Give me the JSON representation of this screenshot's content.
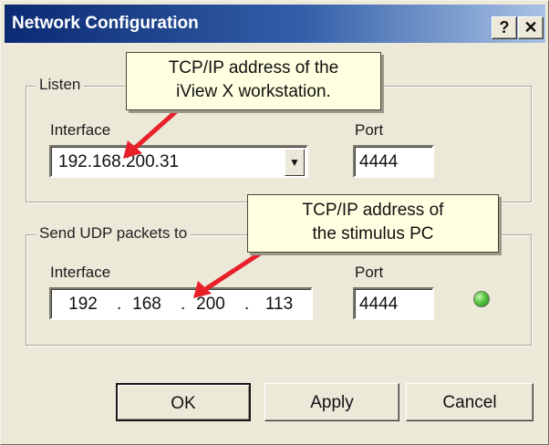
{
  "window": {
    "title": "Network Configuration",
    "help_label": "?",
    "close_label": "✕"
  },
  "listen": {
    "group_label": "Listen",
    "interface_label": "Interface",
    "interface_value": "192.168.200.31",
    "port_label": "Port",
    "port_value": "4444"
  },
  "send": {
    "group_label": "Send UDP packets to",
    "interface_label": "Interface",
    "ip_octets": [
      "192",
      "168",
      "200",
      "113"
    ],
    "ip_separator": ".",
    "port_label": "Port",
    "port_value": "4444"
  },
  "callouts": {
    "top_line1": "TCP/IP address of the",
    "top_line2": "iView X workstation.",
    "bottom_line1": "TCP/IP address of",
    "bottom_line2": "the stimulus PC"
  },
  "buttons": {
    "ok": "OK",
    "apply": "Apply",
    "cancel": "Cancel"
  },
  "icons": {
    "dropdown": "chevron-down-icon",
    "status": "status-led-icon"
  },
  "colors": {
    "titlebar_dark": "#0b2a73",
    "titlebar_light": "#a9c2e5",
    "callout_bg": "#ffffe1",
    "arrow": "#e8202a",
    "led": "#54c63b"
  }
}
